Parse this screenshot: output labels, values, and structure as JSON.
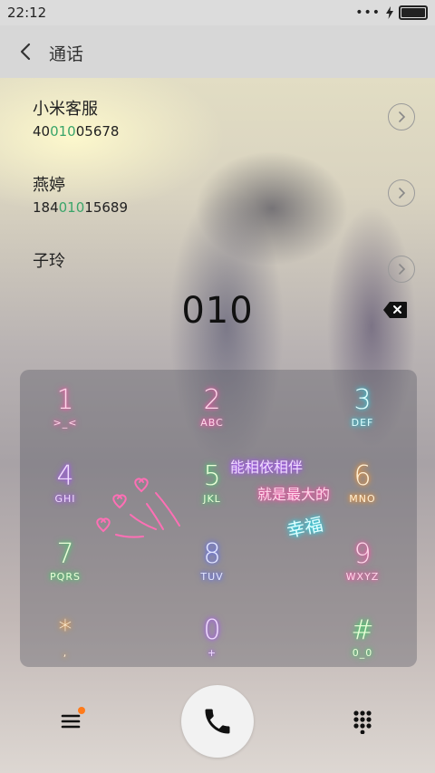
{
  "status_bar": {
    "time": "22:12",
    "more": "•••"
  },
  "header": {
    "title": "通话"
  },
  "results": [
    {
      "name": "小米客服",
      "num_pre": "40",
      "num_match": "010",
      "num_post": "05678"
    },
    {
      "name": "燕婷",
      "num_pre": "184",
      "num_match": "010",
      "num_post": "15689"
    },
    {
      "name": "子玲",
      "num_pre": "",
      "num_match": "",
      "num_post": ""
    }
  ],
  "dial": {
    "number": "010"
  },
  "keypad": {
    "keys": [
      {
        "digit": "1",
        "letters": ">_<"
      },
      {
        "digit": "2",
        "letters": "ABC"
      },
      {
        "digit": "3",
        "letters": "DEF"
      },
      {
        "digit": "4",
        "letters": "GHI"
      },
      {
        "digit": "5",
        "letters": "JKL"
      },
      {
        "digit": "6",
        "letters": "MNO"
      },
      {
        "digit": "7",
        "letters": "PQRS"
      },
      {
        "digit": "8",
        "letters": "TUV"
      },
      {
        "digit": "9",
        "letters": "WXYZ"
      },
      {
        "digit": "*",
        "letters": ","
      },
      {
        "digit": "0",
        "letters": "+"
      },
      {
        "digit": "#",
        "letters": "0_0"
      }
    ],
    "decoration": {
      "line1": "能相依相伴",
      "line2": "就是最大的",
      "line3": "幸福"
    }
  },
  "colors": {
    "match": "#3aa56a",
    "notification_dot": "#ff7a1a"
  },
  "icons": {
    "back": "chevron-left-icon",
    "detail": "chevron-right-icon",
    "delete": "backspace-icon",
    "menu": "menu-icon",
    "call": "phone-icon",
    "dialpad": "dialpad-icon"
  }
}
